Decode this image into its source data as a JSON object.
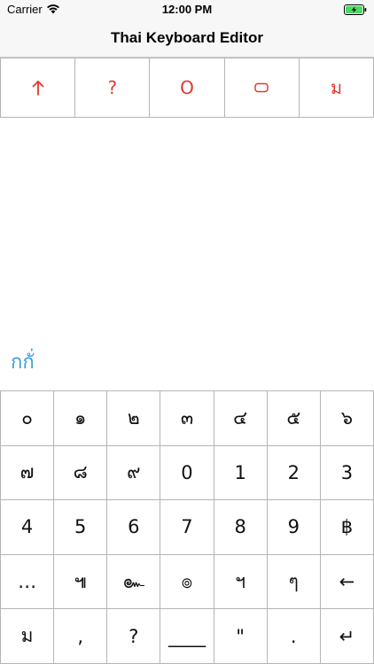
{
  "status_bar": {
    "carrier": "Carrier",
    "time": "12:00 PM",
    "wifi_icon": "wifi-icon",
    "battery_icon": "battery-charging-icon"
  },
  "nav": {
    "title": "Thai Keyboard Editor"
  },
  "colors": {
    "accent": "#e2382f",
    "editor_text": "#3a9ddf",
    "grid_line": "#b5b5b5"
  },
  "toolbar": [
    {
      "name": "arrow-up-icon",
      "label": ""
    },
    {
      "name": "question-button",
      "label": "?"
    },
    {
      "name": "circle-button",
      "label": "O"
    },
    {
      "name": "rounded-rect-icon",
      "label": ""
    },
    {
      "name": "thai-mo-button",
      "label": "ม"
    }
  ],
  "editor": {
    "text": "กกั่"
  },
  "keyboard": {
    "rows": [
      [
        "๐",
        "๑",
        "๒",
        "๓",
        "๔",
        "๕",
        "๖"
      ],
      [
        "๗",
        "๘",
        "๙",
        "0",
        "1",
        "2",
        "3"
      ],
      [
        "4",
        "5",
        "6",
        "7",
        "8",
        "9",
        "฿"
      ],
      [
        "…",
        "๚",
        "๛",
        "๏",
        "ฯ",
        "ๆ",
        "←"
      ],
      [
        "ม",
        ",",
        "?",
        "____",
        "\"",
        ".",
        "↵"
      ]
    ]
  }
}
